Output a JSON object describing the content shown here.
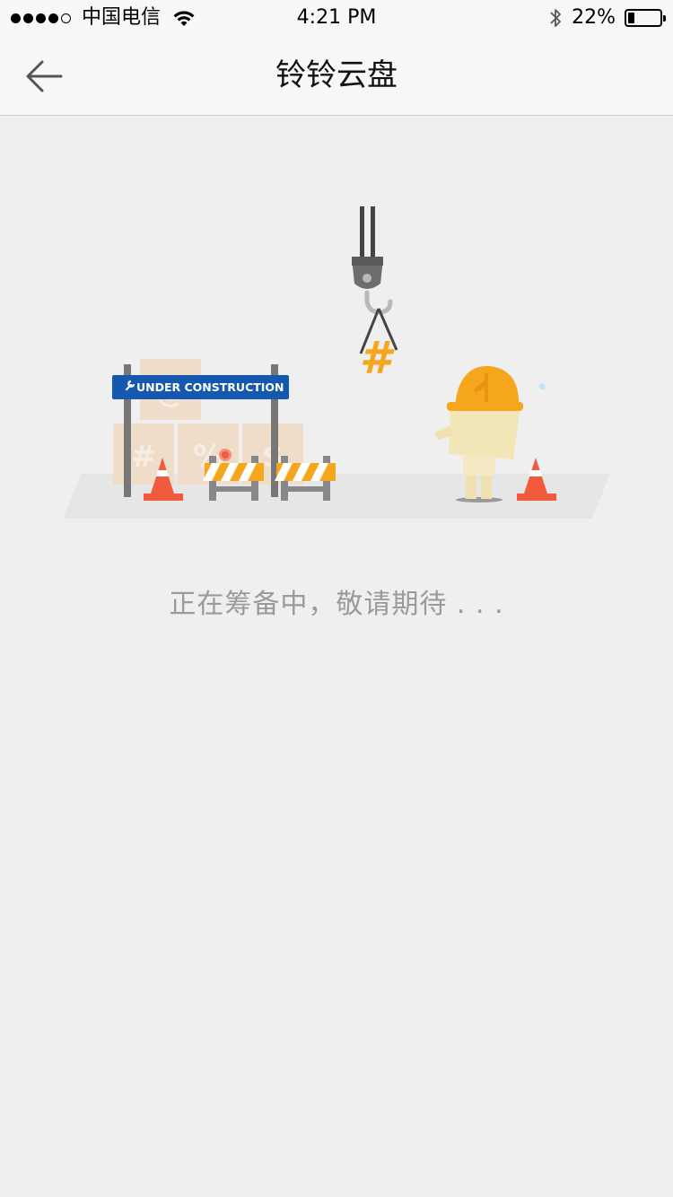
{
  "status_bar": {
    "carrier": "中国电信",
    "time": "4:21 PM",
    "battery_percent_text": "22%",
    "battery_level": 0.22,
    "signal_bars_filled": 4,
    "signal_bars_total": 5
  },
  "nav": {
    "title": "铃铃云盘",
    "back_icon": "arrow-left-icon"
  },
  "illustration": {
    "sign_text": "UNDER CONSTRUCTION",
    "box_symbols": [
      "#",
      "%",
      "$",
      "@"
    ],
    "hook_symbol": "#"
  },
  "message": "正在筹备中，敬请期待 . . ."
}
